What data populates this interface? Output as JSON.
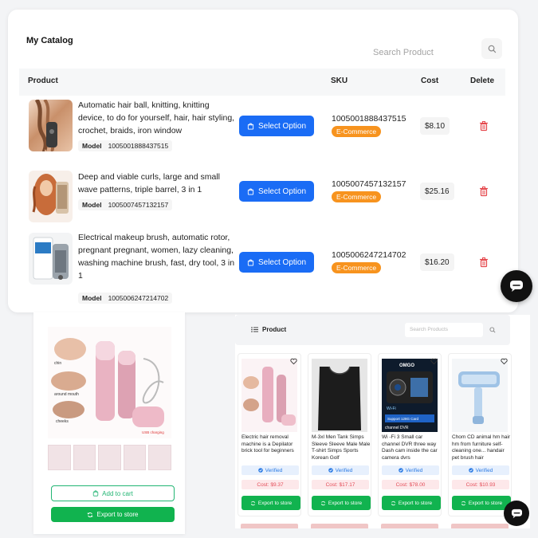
{
  "catalog": {
    "title": "My Catalog",
    "search_placeholder": "Search Product",
    "columns": {
      "product": "Product",
      "sku": "SKU",
      "cost": "Cost",
      "delete": "Delete"
    },
    "rows": [
      {
        "description": "Automatic hair ball, knitting, knitting device, to do for yourself, hair, hair styling, crochet, braids, iron window",
        "model_label": "Model",
        "model": "1005001888437515",
        "select_label": "Select Option",
        "sku": "1005001888437515",
        "tag": "E-Commerce",
        "cost": "$8.10"
      },
      {
        "description": "Deep and viable curls, large and small wave patterns, triple barrel, 3 in 1",
        "model_label": "Model",
        "model": "1005007457132157",
        "select_label": "Select Option",
        "sku": "1005007457132157",
        "tag": "E-Commerce",
        "cost": "$25.16"
      },
      {
        "description": "Electrical makeup brush, automatic rotor, pregnant pregnant, women, lazy cleaning, washing machine brush, fast, dry tool, 3 in 1",
        "model_label": "Model",
        "model": "1005006247214702",
        "select_label": "Select Option",
        "sku": "1005006247214702",
        "tag": "E-Commerce",
        "cost": "$16.20"
      }
    ]
  },
  "detail": {
    "image_labels": [
      "chin",
      "around mouth",
      "cheeks",
      "USB charging"
    ],
    "add_to_cart": "Add to cart",
    "export": "Export to store"
  },
  "grid": {
    "title": "Product",
    "search_placeholder": "Search Products",
    "cards": [
      {
        "title": "Electric hair removal machine is a Depilator brick tool for beginners",
        "verified": "Verified",
        "cost": "Cost: $9.37",
        "export": "Export to store"
      },
      {
        "title": "M-3xl Men Tank Simps Sleeve Sleeve Male Male T-shirt Simps Sports Korean Golf",
        "verified": "Verified",
        "cost": "Cost: $17.17",
        "export": "Export to store"
      },
      {
        "title": "Wi -Fi 3 Small car channel DVR three way Dash cam inside the car camera dvrs",
        "verified": "Verified",
        "cost": "Cost: $78.00",
        "export": "Export to store"
      },
      {
        "title": "Chom CD animal hm hair hm from furniture self-cleaning one... handair pet brush hair",
        "verified": "Verified",
        "cost": "Cost: $10.93",
        "export": "Export to store"
      }
    ],
    "dashcam_labels": [
      "OMGO",
      "Wi-Fi",
      "Support 128G Card",
      "channel DVR"
    ]
  },
  "colors": {
    "primary": "#1a6cf5",
    "tag": "#f7931e",
    "green": "#11b34f",
    "delete": "#e5484d"
  }
}
